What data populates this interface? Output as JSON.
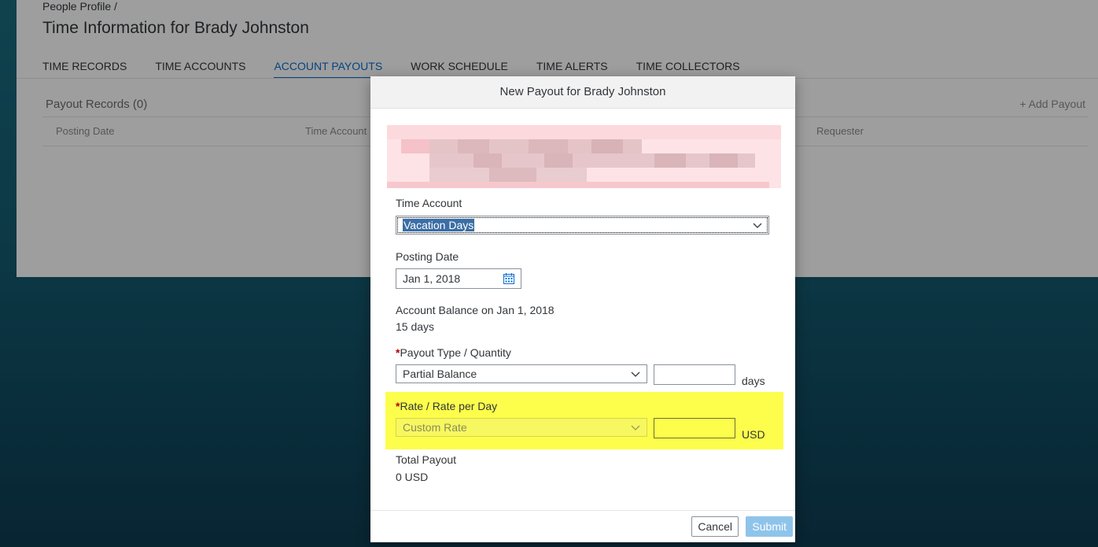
{
  "page": {
    "breadcrumb": "People Profile /",
    "title": "Time Information for Brady Johnston",
    "tabs": [
      {
        "label": "TIME RECORDS"
      },
      {
        "label": "TIME ACCOUNTS"
      },
      {
        "label": "ACCOUNT PAYOUTS"
      },
      {
        "label": "WORK SCHEDULE"
      },
      {
        "label": "TIME ALERTS"
      },
      {
        "label": "TIME COLLECTORS"
      }
    ],
    "active_tab": "ACCOUNT PAYOUTS",
    "records_title": "Payout Records (0)",
    "add_payout_label": "Add Payout",
    "columns": [
      "Posting Date",
      "Time Account",
      "Requester"
    ]
  },
  "dialog": {
    "title": "New Payout for Brady Johnston",
    "time_account": {
      "label": "Time Account",
      "value": "Vacation Days"
    },
    "posting_date": {
      "label": "Posting Date",
      "value": "Jan 1, 2018"
    },
    "balance": {
      "label": "Account Balance on Jan 1, 2018",
      "value": "15 days"
    },
    "payout_type": {
      "required_mark": "*",
      "label": "Payout Type / Quantity",
      "value": "Partial Balance",
      "quantity": "",
      "unit": "days"
    },
    "rate": {
      "required_mark": "*",
      "label": "Rate / Rate per Day",
      "value": "Custom Rate",
      "amount": "",
      "unit": "USD"
    },
    "total": {
      "label": "Total Payout",
      "value": "0 USD"
    },
    "buttons": {
      "cancel": "Cancel",
      "submit": "Submit"
    }
  },
  "colors": {
    "accent": "#0a6ed1",
    "highlight": "#fdfd4c",
    "required": "#bb0000",
    "submit_disabled": "#8fc4ea"
  }
}
